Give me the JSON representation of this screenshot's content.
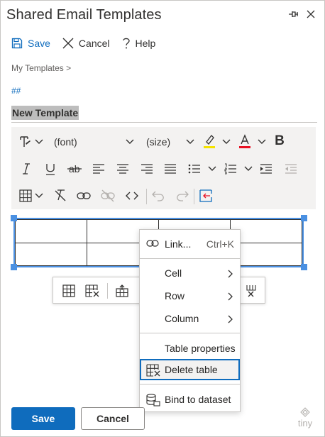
{
  "header": {
    "title": "Shared Email Templates"
  },
  "commands": {
    "save": "Save",
    "cancel": "Cancel",
    "help": "Help"
  },
  "breadcrumb": "My Templates >",
  "hash_link": "##",
  "template_name": "New Template",
  "toolbar": {
    "font_placeholder": "(font)",
    "size_placeholder": "(size)",
    "bold_glyph": "B",
    "highlight_color": "#f5e300",
    "font_color": "#e81123",
    "icons_row1": [
      "paragraph-format-icon",
      "highlight-icon",
      "font-color-icon",
      "bold-icon"
    ],
    "icons_row2": [
      "italic-icon",
      "underline-icon",
      "strikethrough-icon",
      "align-left-icon",
      "align-center-icon",
      "align-right-icon",
      "justify-icon",
      "bullet-list-icon",
      "numbered-list-icon",
      "indent-icon",
      "outdent-icon"
    ],
    "icons_row3": [
      "table-icon",
      "clear-formatting-icon",
      "link-icon",
      "unlink-icon",
      "source-code-icon",
      "undo-icon",
      "redo-icon",
      "insert-template-icon"
    ]
  },
  "context_menu": {
    "link_label": "Link...",
    "link_shortcut": "Ctrl+K",
    "cell": "Cell",
    "row": "Row",
    "column": "Column",
    "table_properties": "Table properties",
    "delete_table": "Delete table",
    "bind_dataset": "Bind to dataset"
  },
  "footer": {
    "save": "Save",
    "cancel": "Cancel",
    "brand": "tiny"
  },
  "colors": {
    "accent": "#0f6cbd",
    "selection": "#4a90e2"
  }
}
